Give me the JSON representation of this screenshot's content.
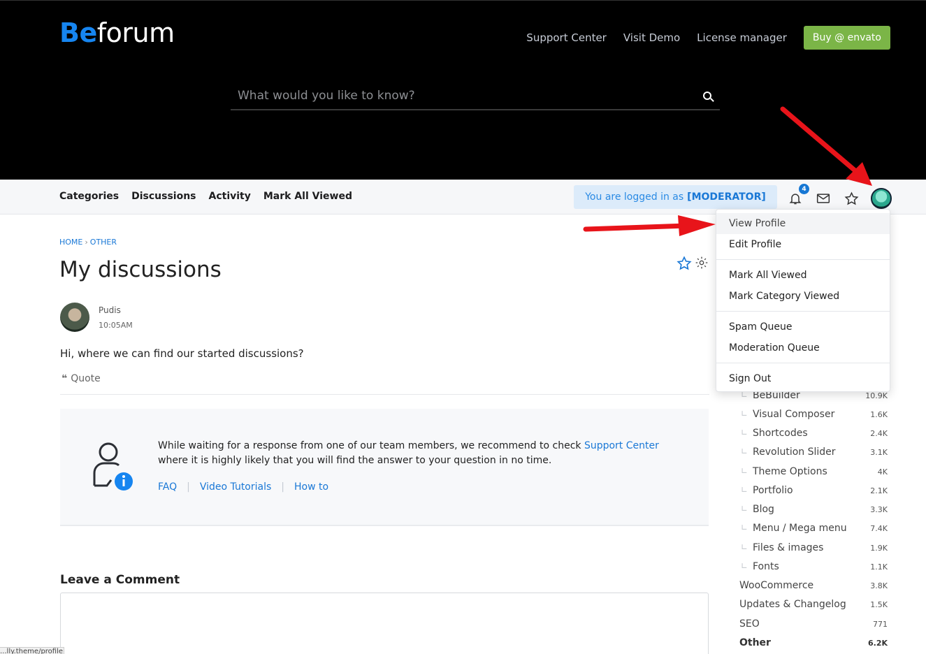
{
  "header": {
    "logo_prefix": "Be",
    "logo_suffix": "forum",
    "nav": [
      "Support Center",
      "Visit Demo",
      "License manager"
    ],
    "buy_label": "Buy @ envato",
    "search_placeholder": "What would you like to know?"
  },
  "subnav": {
    "links": [
      "Categories",
      "Discussions",
      "Activity",
      "Mark All Viewed"
    ],
    "logged_prefix": "You are logged in as",
    "logged_role": "[MODERATOR]",
    "notification_count": "4"
  },
  "breadcrumb": [
    "HOME",
    "OTHER"
  ],
  "discussion": {
    "title": "My discussions",
    "author": "Pudis",
    "time": "10:05AM",
    "body": "Hi, where we can find our started discussions?",
    "quote_label": "Quote"
  },
  "help": {
    "text_before": "While waiting for a response from one of our team members, we recommend to check",
    "link": "Support Center",
    "text_after": "where it is highly likely that you will find the answer to your question in no time.",
    "links": [
      "FAQ",
      "Video Tutorials",
      "How to"
    ]
  },
  "comment": {
    "title": "Leave a Comment"
  },
  "status_url": "...lly.theme/profile",
  "dropdown": {
    "groups": [
      [
        "View Profile",
        "Edit Profile"
      ],
      [
        "Mark All Viewed",
        "Mark Category Viewed"
      ],
      [
        "Spam Queue",
        "Moderation Queue"
      ],
      [
        "Sign Out"
      ]
    ]
  },
  "categories": [
    {
      "name": "BeBuilder",
      "count": "10.9K",
      "child": true
    },
    {
      "name": "Visual Composer",
      "count": "1.6K",
      "child": true
    },
    {
      "name": "Shortcodes",
      "count": "2.4K",
      "child": true
    },
    {
      "name": "Revolution Slider",
      "count": "3.1K",
      "child": true
    },
    {
      "name": "Theme Options",
      "count": "4K",
      "child": true
    },
    {
      "name": "Portfolio",
      "count": "2.1K",
      "child": true
    },
    {
      "name": "Blog",
      "count": "3.3K",
      "child": true
    },
    {
      "name": "Menu / Mega menu",
      "count": "7.4K",
      "child": true
    },
    {
      "name": "Files & images",
      "count": "1.9K",
      "child": true
    },
    {
      "name": "Fonts",
      "count": "1.1K",
      "child": true
    },
    {
      "name": "WooCommerce",
      "count": "3.8K",
      "child": false
    },
    {
      "name": "Updates & Changelog",
      "count": "1.5K",
      "child": false
    },
    {
      "name": "SEO",
      "count": "771",
      "child": false
    },
    {
      "name": "Other",
      "count": "6.2K",
      "child": false,
      "active": true
    }
  ],
  "colors": {
    "accent": "#1a78d6",
    "buy": "#7bb547",
    "arrow": "#e8141a"
  }
}
